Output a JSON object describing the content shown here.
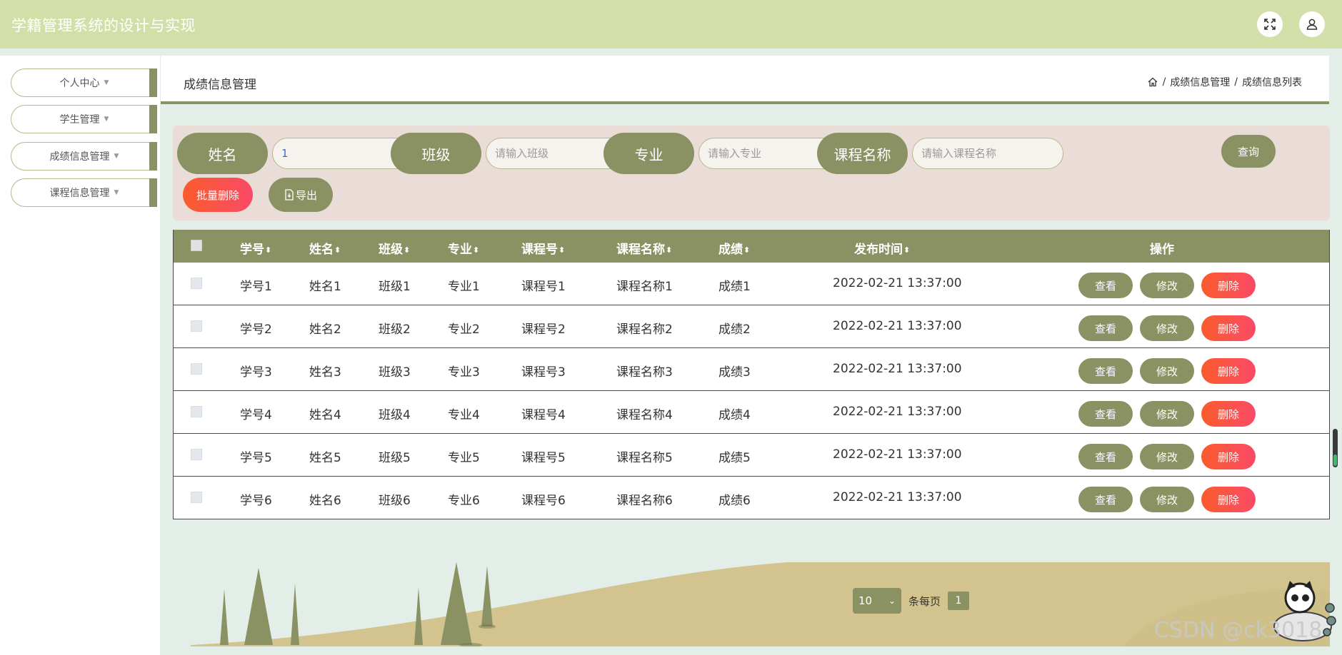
{
  "app": {
    "title": "学籍管理系统的设计与实现"
  },
  "topbar": {
    "icons": [
      "fullscreen-icon",
      "user-icon"
    ]
  },
  "sidebar": {
    "items": [
      {
        "label": "个人中心"
      },
      {
        "label": "学生管理"
      },
      {
        "label": "成绩信息管理"
      },
      {
        "label": "课程信息管理"
      }
    ]
  },
  "header": {
    "title": "成绩信息管理",
    "breadcrumb": [
      "成绩信息管理",
      "成绩信息列表"
    ],
    "separator": "/"
  },
  "search": {
    "name": {
      "label": "姓名",
      "value": "1"
    },
    "class": {
      "label": "班级",
      "placeholder": "请输入班级"
    },
    "major": {
      "label": "专业",
      "placeholder": "请输入专业"
    },
    "course": {
      "label": "课程名称",
      "placeholder": "请输入课程名称"
    },
    "query_label": "查询",
    "batch_delete_label": "批量删除",
    "export_label": "导出"
  },
  "table": {
    "columns": [
      "学号",
      "姓名",
      "班级",
      "专业",
      "课程号",
      "课程名称",
      "成绩",
      "发布时间",
      "操作"
    ],
    "rows": [
      [
        "学号1",
        "姓名1",
        "班级1",
        "专业1",
        "课程号1",
        "课程名称1",
        "成绩1",
        "2022-02-21 13:37:00"
      ],
      [
        "学号2",
        "姓名2",
        "班级2",
        "专业2",
        "课程号2",
        "课程名称2",
        "成绩2",
        "2022-02-21 13:37:00"
      ],
      [
        "学号3",
        "姓名3",
        "班级3",
        "专业3",
        "课程号3",
        "课程名称3",
        "成绩3",
        "2022-02-21 13:37:00"
      ],
      [
        "学号4",
        "姓名4",
        "班级4",
        "专业4",
        "课程号4",
        "课程名称4",
        "成绩4",
        "2022-02-21 13:37:00"
      ],
      [
        "学号5",
        "姓名5",
        "班级5",
        "专业5",
        "课程号5",
        "课程名称5",
        "成绩5",
        "2022-02-21 13:37:00"
      ],
      [
        "学号6",
        "姓名6",
        "班级6",
        "专业6",
        "课程号6",
        "课程名称6",
        "成绩6",
        "2022-02-21 13:37:00"
      ]
    ],
    "actions": {
      "view": "查看",
      "edit": "修改",
      "delete": "删除"
    }
  },
  "pagination": {
    "page_size": "10",
    "per_page_label": "条每页",
    "current_page": "1"
  },
  "watermark": "CSDN @ck3018",
  "colors": {
    "topbar": "#d3dfa8",
    "accent": "#8a9162",
    "danger": "#fb5c2c",
    "search_panel": "#eadcd6"
  }
}
